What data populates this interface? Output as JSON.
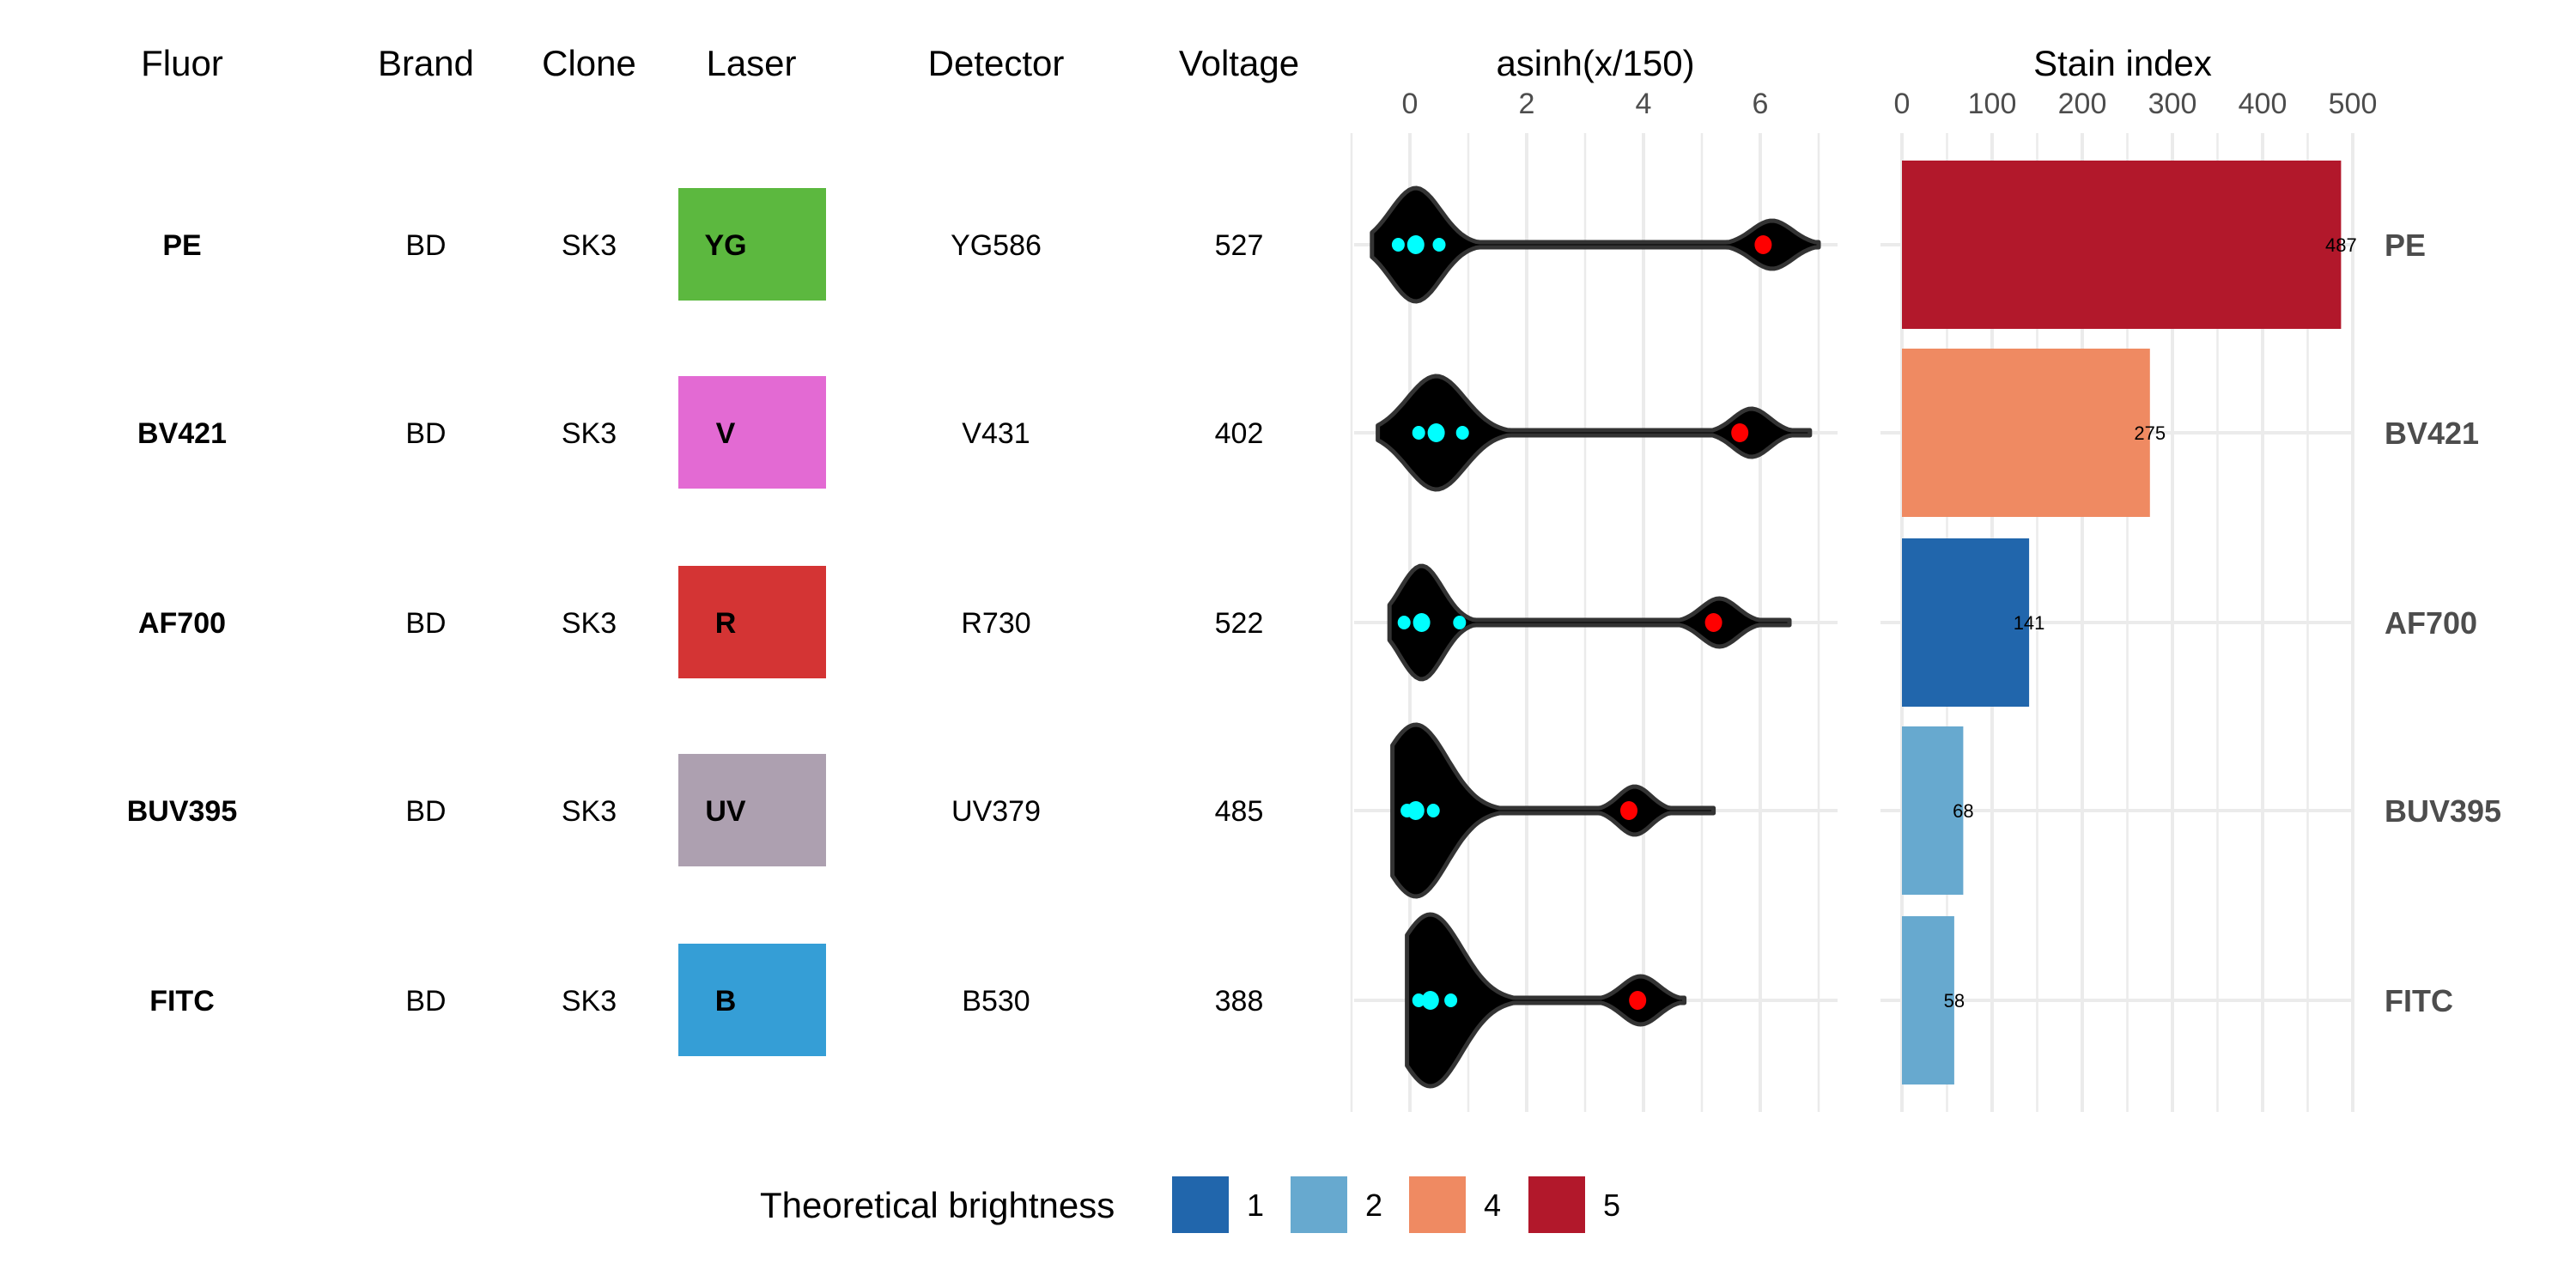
{
  "table": {
    "headers": [
      "Fluor",
      "Brand",
      "Clone",
      "Laser",
      "Detector",
      "Voltage"
    ],
    "rows": [
      {
        "fluor": "PE",
        "brand": "BD",
        "clone": "SK3",
        "laser": "YG",
        "laser_color": "#5cb83f",
        "detector": "YG586",
        "voltage": "527"
      },
      {
        "fluor": "BV421",
        "brand": "BD",
        "clone": "SK3",
        "laser": "V",
        "laser_color": "#e36ad3",
        "detector": "V431",
        "voltage": "402"
      },
      {
        "fluor": "AF700",
        "brand": "BD",
        "clone": "SK3",
        "laser": "R",
        "laser_color": "#d43434",
        "detector": "R730",
        "voltage": "522"
      },
      {
        "fluor": "BUV395",
        "brand": "BD",
        "clone": "SK3",
        "laser": "UV",
        "laser_color": "#ada0b0",
        "detector": "UV379",
        "voltage": "485"
      },
      {
        "fluor": "FITC",
        "brand": "BD",
        "clone": "SK3",
        "laser": "B",
        "laser_color": "#359ed6",
        "detector": "B530",
        "voltage": "388"
      }
    ]
  },
  "chart_data": [
    {
      "type": "violin",
      "title": "asinh(x/150)",
      "xlabel": "asinh(x/150)",
      "xlim": [
        -1,
        7
      ],
      "x_ticks": [
        0,
        2,
        4,
        6
      ],
      "grid": true,
      "categories": [
        "PE",
        "BV421",
        "AF700",
        "BUV395",
        "FITC"
      ],
      "series": [
        {
          "name": "PE",
          "negative_peak": 0.1,
          "negative_halfwidth": 0.95,
          "positive_peak": 6.2,
          "positive_halfwidth": 0.5,
          "range": [
            -0.65,
            7.0
          ],
          "negative_points": [
            -0.2,
            0.1,
            0.5
          ],
          "positive_point": 6.05
        },
        {
          "name": "BV421",
          "negative_peak": 0.45,
          "negative_halfwidth": 1.1,
          "positive_peak": 5.85,
          "positive_halfwidth": 0.45,
          "range": [
            -0.55,
            6.85
          ],
          "negative_points": [
            0.15,
            0.45,
            0.9
          ],
          "positive_point": 5.65
        },
        {
          "name": "AF700",
          "negative_peak": 0.2,
          "negative_halfwidth": 0.8,
          "positive_peak": 5.3,
          "positive_halfwidth": 0.45,
          "range": [
            -0.35,
            6.5
          ],
          "negative_points": [
            -0.1,
            0.2,
            0.85
          ],
          "positive_point": 5.2
        },
        {
          "name": "BUV395",
          "negative_peak": 0.1,
          "negative_halfwidth": 1.2,
          "positive_peak": 3.85,
          "positive_halfwidth": 0.4,
          "range": [
            -0.3,
            5.2
          ],
          "negative_points": [
            -0.05,
            0.1,
            0.4
          ],
          "positive_point": 3.75
        },
        {
          "name": "FITC",
          "negative_peak": 0.35,
          "negative_halfwidth": 1.2,
          "positive_peak": 3.95,
          "positive_halfwidth": 0.45,
          "range": [
            -0.05,
            4.7
          ],
          "negative_points": [
            0.15,
            0.35,
            0.7
          ],
          "positive_point": 3.9
        }
      ],
      "negative_point_color": "#00ffff",
      "positive_point_color": "#ff0000"
    },
    {
      "type": "bar",
      "orientation": "horizontal",
      "title": "Stain index",
      "xlabel": "Stain index",
      "xlim": [
        0,
        500
      ],
      "x_ticks": [
        0,
        100,
        200,
        300,
        400,
        500
      ],
      "grid": true,
      "categories": [
        "PE",
        "BV421",
        "AF700",
        "BUV395",
        "FITC"
      ],
      "values": [
        487,
        275,
        141,
        68,
        58
      ],
      "brightness": [
        "5",
        "4",
        "1",
        "2",
        "2"
      ],
      "data_labels": [
        "487",
        "275",
        "141",
        "68",
        "58"
      ]
    }
  ],
  "legend": {
    "title": "Theoretical brightness",
    "position": "bottom",
    "items": [
      {
        "label": "1",
        "color": "#2166ac"
      },
      {
        "label": "2",
        "color": "#67a9cf"
      },
      {
        "label": "4",
        "color": "#ef8a62"
      },
      {
        "label": "5",
        "color": "#b2182b"
      }
    ]
  }
}
